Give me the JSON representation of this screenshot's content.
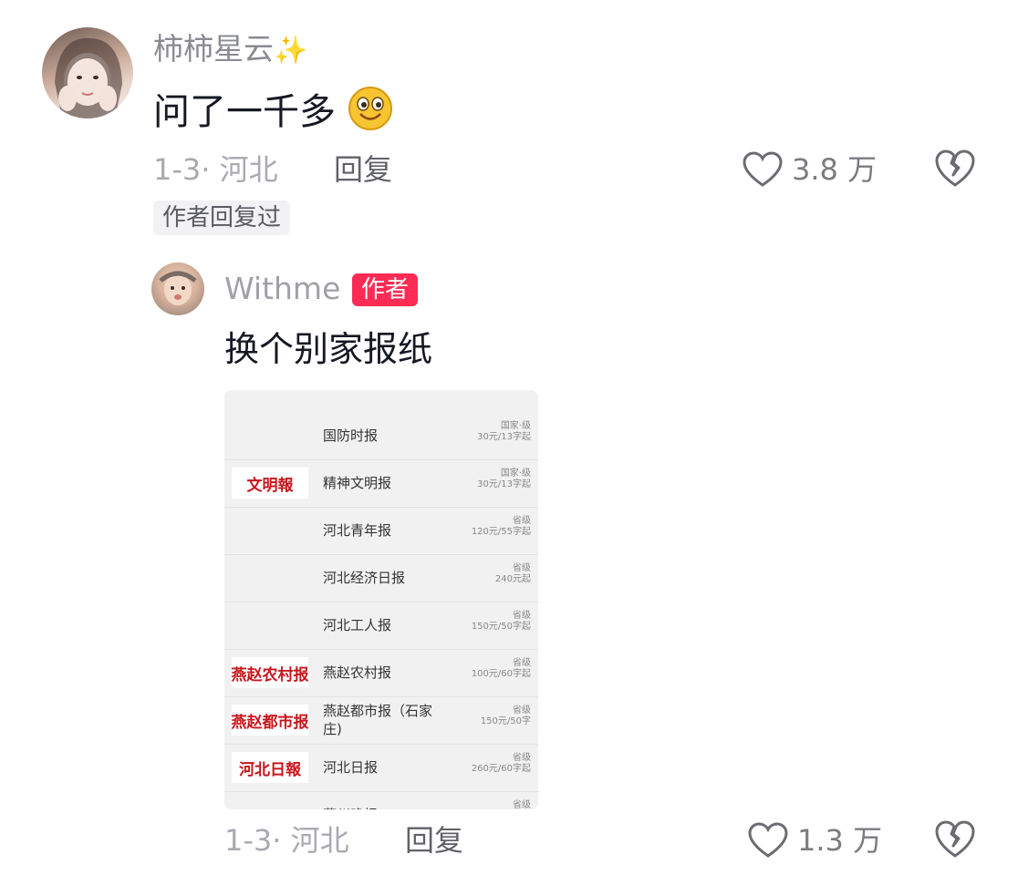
{
  "comment": {
    "username": "柿柿星云",
    "username_emoji": "✨",
    "text": "问了一千多",
    "emoji": "🙂",
    "date_location": "1-3· 河北",
    "reply_label": "回复",
    "like_count": "3.8 万",
    "tag": "作者回复过"
  },
  "reply": {
    "username": "Withme",
    "author_badge": "作者",
    "text": "换个别家报纸",
    "date_location": "1-3· 河北",
    "reply_label": "回复",
    "like_count": "1.3 万"
  },
  "papers": [
    {
      "name": "国防时报",
      "logo": "",
      "level": "国家·级",
      "price": "30元/13字起"
    },
    {
      "name": "精神文明报",
      "logo": "文明報",
      "level": "国家·级",
      "price": "30元/13字起"
    },
    {
      "name": "河北青年报",
      "logo": "",
      "level": "省级",
      "price": "120元/55字起"
    },
    {
      "name": "河北经济日报",
      "logo": "",
      "level": "省级",
      "price": "240元起"
    },
    {
      "name": "河北工人报",
      "logo": "",
      "level": "省级",
      "price": "150元/50字起"
    },
    {
      "name": "燕赵农村报",
      "logo": "燕赵农村报",
      "level": "省级",
      "price": "100元/60字起"
    },
    {
      "name": "燕赵都市报（石家庄)",
      "logo": "燕赵都市报",
      "level": "省级",
      "price": "150元/50字"
    },
    {
      "name": "河北日报",
      "logo": "河北日報",
      "level": "省级",
      "price": "260元/60字起"
    },
    {
      "name": "燕州晚报",
      "logo": "",
      "level": "省级",
      "price": ""
    }
  ]
}
